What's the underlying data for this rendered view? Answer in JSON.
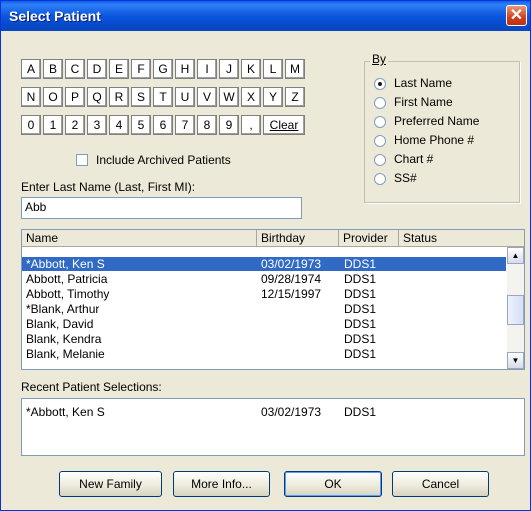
{
  "window": {
    "title": "Select Patient",
    "close_glyph": "✕"
  },
  "keypad": {
    "letters_row1": [
      "A",
      "B",
      "C",
      "D",
      "E",
      "F",
      "G",
      "H",
      "I",
      "J",
      "K",
      "L",
      "M"
    ],
    "letters_row2": [
      "N",
      "O",
      "P",
      "Q",
      "R",
      "S",
      "T",
      "U",
      "V",
      "W",
      "X",
      "Y",
      "Z"
    ],
    "digits_row": [
      "0",
      "1",
      "2",
      "3",
      "4",
      "5",
      "6",
      "7",
      "8",
      "9",
      ","
    ],
    "clear_label": "Clear"
  },
  "archived": {
    "label": "Include Archived Patients",
    "checked": false
  },
  "by": {
    "group_label": "By",
    "options": [
      "Last Name",
      "First Name",
      "Preferred Name",
      "Home Phone #",
      "Chart #",
      "SS#"
    ],
    "selected_index": 0
  },
  "search": {
    "label": "Enter Last Name (Last, First MI):",
    "value": "Abb"
  },
  "patients": {
    "columns": [
      "Name",
      "Birthday",
      "Provider",
      "Status"
    ],
    "rows": [
      {
        "name": "*Abbott, Ken S",
        "birthday": "03/02/1973",
        "provider": "DDS1",
        "status": "",
        "selected": true
      },
      {
        "name": "Abbott, Patricia",
        "birthday": "09/28/1974",
        "provider": "DDS1",
        "status": ""
      },
      {
        "name": "Abbott, Timothy",
        "birthday": "12/15/1997",
        "provider": "DDS1",
        "status": ""
      },
      {
        "name": "*Blank, Arthur",
        "birthday": "",
        "provider": "DDS1",
        "status": ""
      },
      {
        "name": "Blank, David",
        "birthday": "",
        "provider": "DDS1",
        "status": ""
      },
      {
        "name": "Blank, Kendra",
        "birthday": "",
        "provider": "DDS1",
        "status": ""
      },
      {
        "name": "Blank, Melanie",
        "birthday": "",
        "provider": "DDS1",
        "status": ""
      }
    ]
  },
  "recent": {
    "label": "Recent Patient Selections:",
    "rows": [
      {
        "name": "*Abbott, Ken S",
        "birthday": "03/02/1973",
        "provider": "DDS1"
      }
    ]
  },
  "buttons": {
    "new_family": "New Family",
    "more_info": "More Info...",
    "ok": "OK",
    "cancel": "Cancel"
  },
  "colors": {
    "selection": "#316ac5",
    "titlebar": "#0b56df",
    "face": "#ece9d8"
  }
}
